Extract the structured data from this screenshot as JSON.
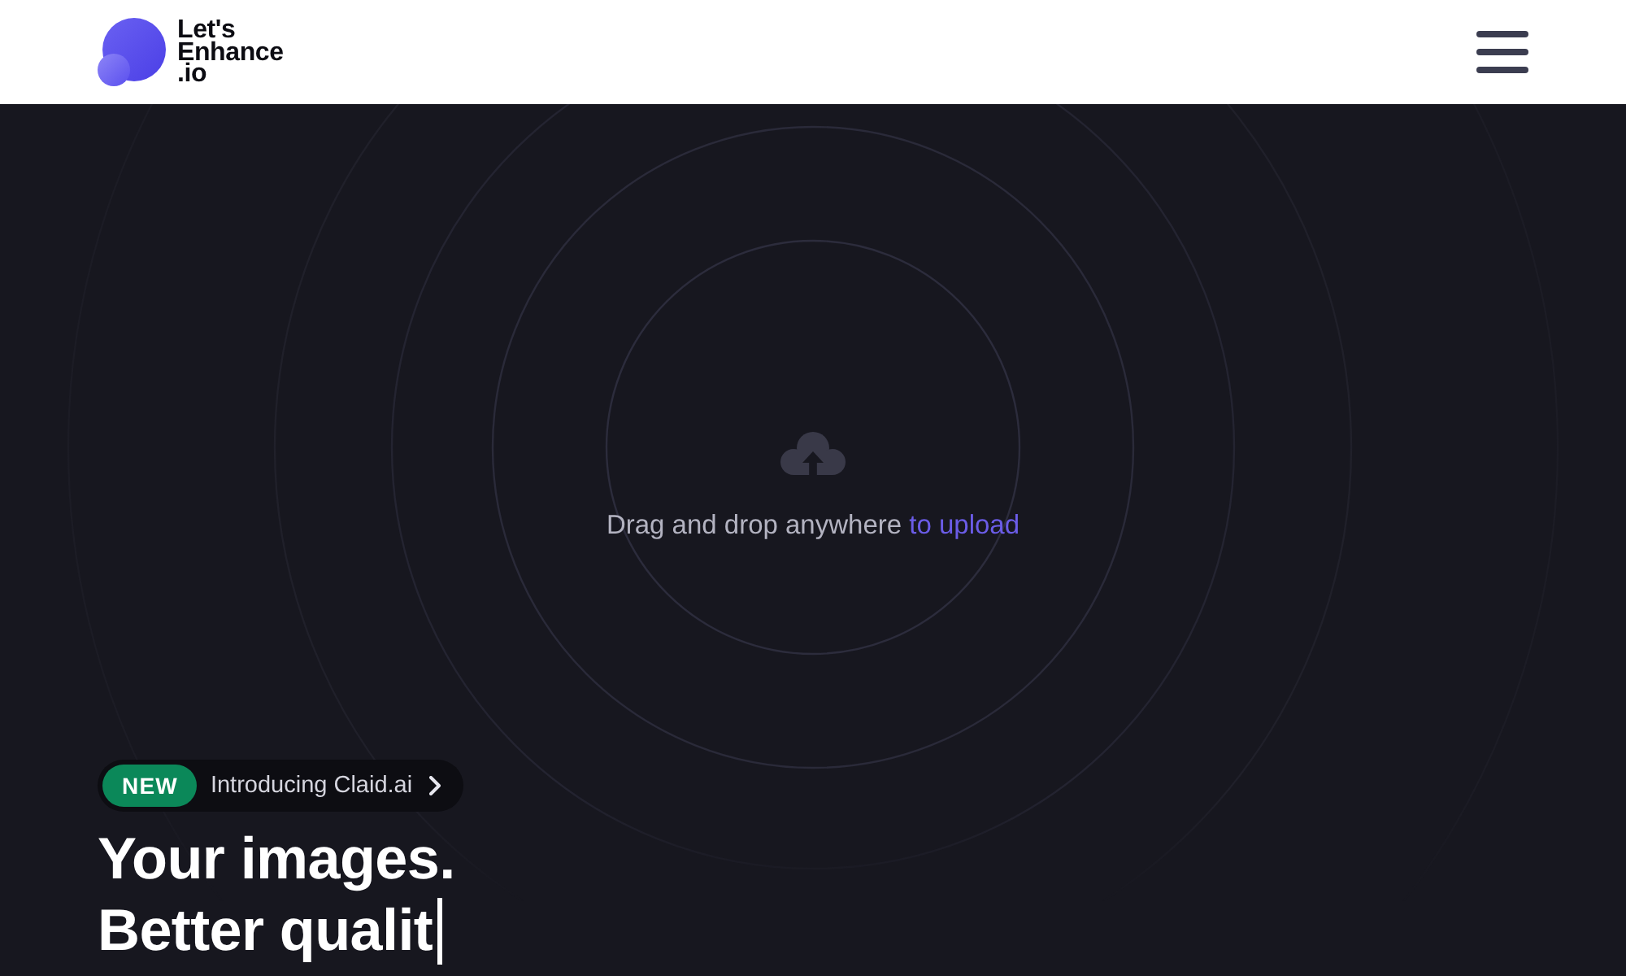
{
  "header": {
    "logo_text": [
      "Let's",
      "Enhance",
      ".io"
    ]
  },
  "dropzone": {
    "prompt": "Drag and drop anywhere",
    "link": "to upload"
  },
  "hero": {
    "announcement": {
      "badge": "NEW",
      "text": "Introducing Claid.ai"
    },
    "headline": [
      "Your images.",
      "Better qualit"
    ],
    "typing_cursor": true
  }
}
